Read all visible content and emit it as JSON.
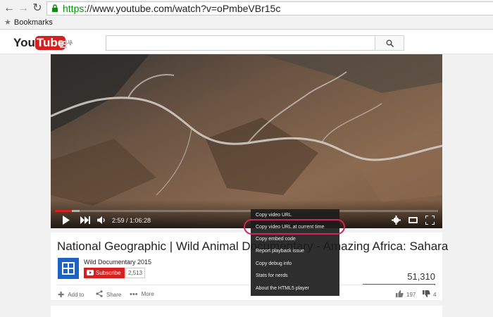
{
  "browser": {
    "url_secure": "https",
    "url_rest": "://www.youtube.com/watch?v=oPmbeVBr15c",
    "bookmarks_label": "Bookmarks"
  },
  "header": {
    "logo_you": "You",
    "logo_tube": "Tube",
    "logo_region": "UA",
    "search_value": ""
  },
  "player": {
    "time": "2:59 / 1:06:28",
    "progress_played": 0.045,
    "progress_loaded": 0.065
  },
  "context_menu": {
    "items": [
      "Copy video URL",
      "Copy video URL at current time",
      "Copy embed code",
      "Report playback issue",
      "Copy debug info",
      "Stats for nerds",
      "About the HTML5 player"
    ],
    "highlighted": "Copy video URL at current time"
  },
  "video": {
    "title": "National Geographic | Wild Animal Documentary - Amazing Africa: Sahara",
    "channel": "Wild Documentary 2015",
    "subscribe_label": "Subscribe",
    "subscriber_count": "2,513",
    "views": "51,310",
    "actions": {
      "add_to": "Add to",
      "share": "Share",
      "more": "More"
    },
    "likes": "197",
    "dislikes": "4"
  },
  "colors": {
    "accent": "#d71f1f",
    "highlight_ring": "#d0245a",
    "views_bar": "#167ac6"
  }
}
